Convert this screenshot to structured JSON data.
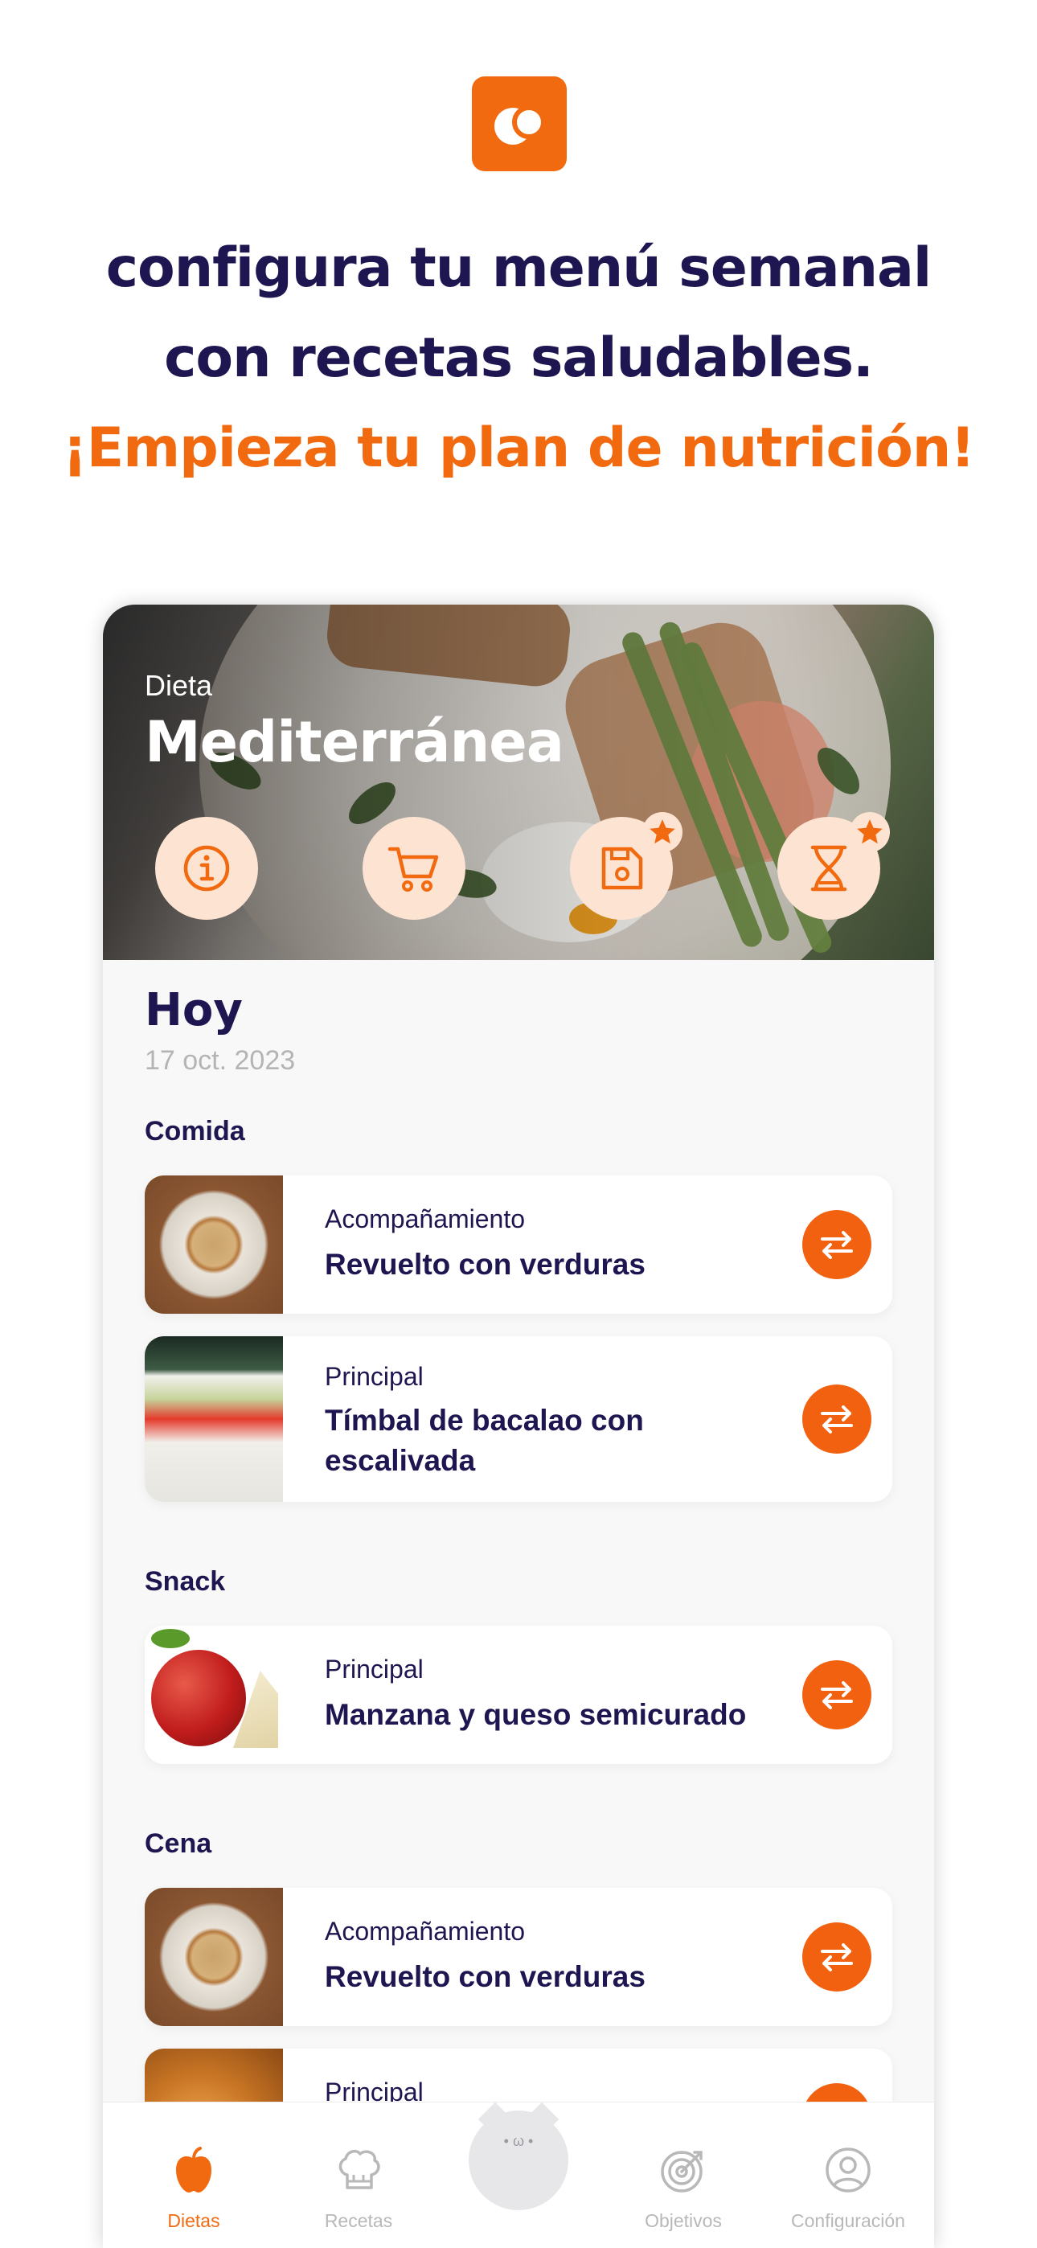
{
  "promo": {
    "line1": "configura tu menú semanal",
    "line2": "con recetas saludables.",
    "line3": "¡Empieza tu plan de nutrición!"
  },
  "hero": {
    "kicker": "Dieta",
    "diet_name": "Mediterránea",
    "buttons": [
      {
        "icon": "info-icon",
        "starred": false
      },
      {
        "icon": "cart-icon",
        "starred": false
      },
      {
        "icon": "save-icon",
        "starred": true
      },
      {
        "icon": "dna-icon",
        "starred": true
      }
    ]
  },
  "day": {
    "title": "Hoy",
    "date": "17 oct. 2023"
  },
  "sections": {
    "comida": "Comida",
    "snack": "Snack",
    "cena": "Cena"
  },
  "meals": [
    {
      "kind": "Acompañamiento",
      "name": "Revuelto con verduras"
    },
    {
      "kind": "Principal",
      "name": "Tímbal de bacalao con escalivada"
    },
    {
      "kind": "Principal",
      "name": "Manzana y queso semicurado"
    },
    {
      "kind": "Acompañamiento",
      "name": "Revuelto con verduras"
    },
    {
      "kind": "Principal",
      "name": ""
    }
  ],
  "nav": {
    "items": [
      "Dietas",
      "Recetas",
      "",
      "Objetivos",
      "Configuración"
    ],
    "active": "Dietas"
  },
  "colors": {
    "accent": "#f26a10",
    "navy": "#1e1650",
    "soft_peach": "#fde3d2"
  }
}
